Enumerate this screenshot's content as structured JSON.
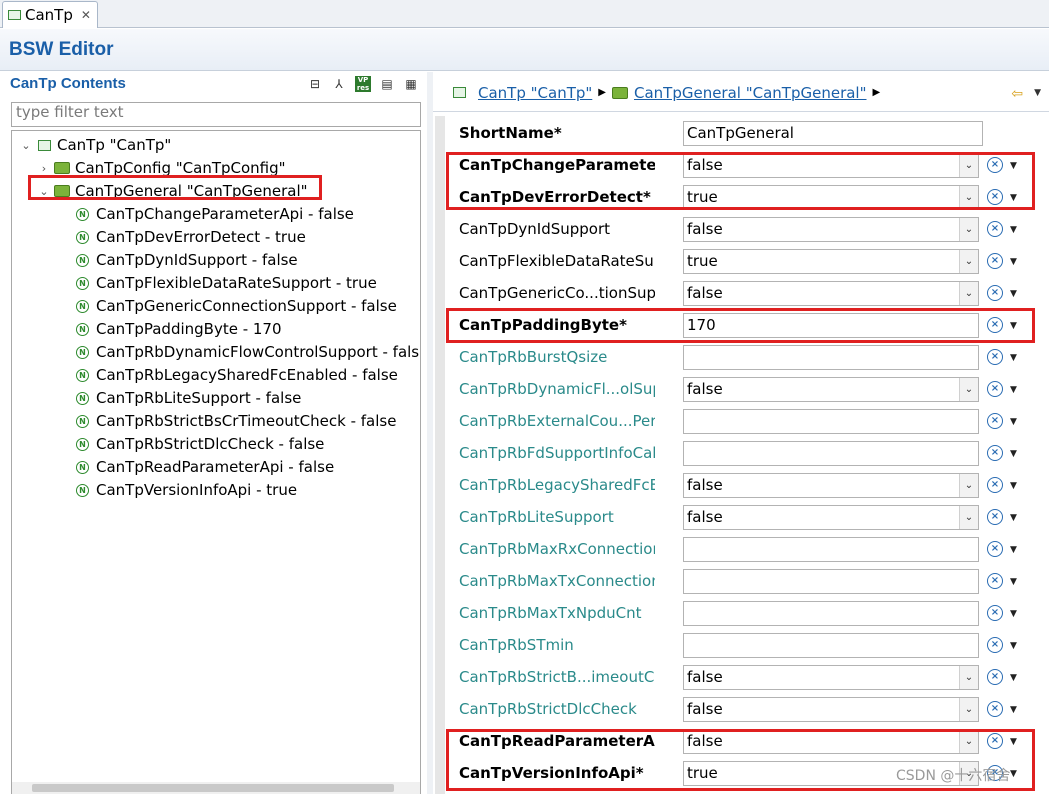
{
  "tab": {
    "label": "CanTp"
  },
  "editor": {
    "title": "BSW Editor"
  },
  "left": {
    "header": "CanTp Contents",
    "filter_placeholder": "type filter text",
    "tree": {
      "root": "CanTp \"CanTp\"",
      "config": "CanTpConfig \"CanTpConfig\"",
      "general": "CanTpGeneral \"CanTpGeneral\"",
      "params": [
        "CanTpChangeParameterApi - false",
        "CanTpDevErrorDetect - true",
        "CanTpDynIdSupport - false",
        "CanTpFlexibleDataRateSupport - true",
        "CanTpGenericConnectionSupport - false",
        "CanTpPaddingByte - 170",
        "CanTpRbDynamicFlowControlSupport - false",
        "CanTpRbLegacySharedFcEnabled - false",
        "CanTpRbLiteSupport - false",
        "CanTpRbStrictBsCrTimeoutCheck - false",
        "CanTpRbStrictDlcCheck - false",
        "CanTpReadParameterApi - false",
        "CanTpVersionInfoApi - true"
      ]
    }
  },
  "breadcrumb": {
    "item1": "CanTp \"CanTp\"",
    "item2": "CanTpGeneral \"CanTpGeneral\""
  },
  "form": {
    "shortname_label": "ShortName*",
    "shortname_value": "CanTpGeneral",
    "rows": [
      {
        "label": "CanTpChangeParameterA",
        "value": "false"
      },
      {
        "label": "CanTpDevErrorDetect*",
        "value": "true"
      },
      {
        "label": "CanTpDynIdSupport",
        "value": "false"
      },
      {
        "label": "CanTpFlexibleDataRateSup",
        "value": "true"
      },
      {
        "label": "CanTpGenericCo...tionSupp",
        "value": "false"
      },
      {
        "label": "CanTpPaddingByte*",
        "value": "170"
      },
      {
        "label": "CanTpRbBurstQsize",
        "value": ""
      },
      {
        "label": "CanTpRbDynamicFl...olSupp",
        "value": "false"
      },
      {
        "label": "CanTpRbExternalCou...PerT",
        "value": ""
      },
      {
        "label": "CanTpRbFdSupportInfoCall",
        "value": ""
      },
      {
        "label": "CanTpRbLegacySharedFcEr",
        "value": "false"
      },
      {
        "label": "CanTpRbLiteSupport",
        "value": "false"
      },
      {
        "label": "CanTpRbMaxRxConnectior",
        "value": ""
      },
      {
        "label": "CanTpRbMaxTxConnection",
        "value": ""
      },
      {
        "label": "CanTpRbMaxTxNpduCnt",
        "value": ""
      },
      {
        "label": "CanTpRbSTmin",
        "value": ""
      },
      {
        "label": "CanTpRbStrictB...imeoutCh",
        "value": "false"
      },
      {
        "label": "CanTpRbStrictDlcCheck",
        "value": "false"
      },
      {
        "label": "CanTpReadParameterApi*",
        "value": "false"
      },
      {
        "label": "CanTpVersionInfoApi*",
        "value": "true"
      }
    ]
  },
  "watermark": "CSDN @十六宿舍",
  "colors": {
    "accent": "#1a5fa8",
    "highlight": "#e02020",
    "teal_label": "#2a8a8a"
  }
}
